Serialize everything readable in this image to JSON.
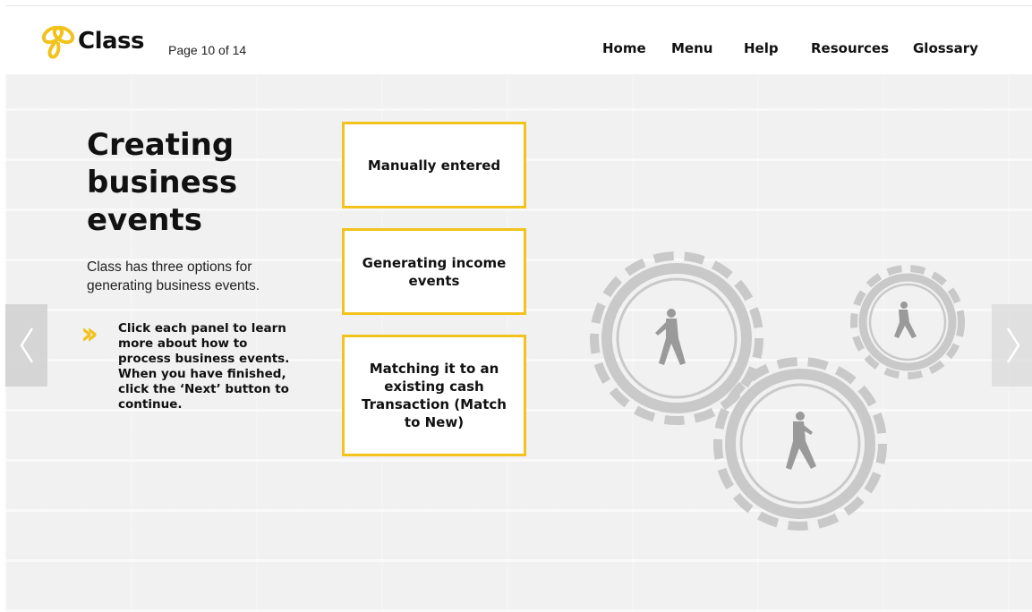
{
  "header": {
    "logo_text": "Class",
    "page_counter": "Page 10 of 14",
    "nav": [
      {
        "label": "Home"
      },
      {
        "label": "Menu"
      },
      {
        "label": "Help"
      },
      {
        "label": "Resources"
      },
      {
        "label": "Glossary"
      }
    ]
  },
  "content": {
    "title_lines": [
      "Creating",
      "business",
      "events"
    ],
    "intro": "Class has three options for generating business events.",
    "instruction": "Click each panel to learn more about how to process business events. When you have finished, click the ‘Next’ button to continue.",
    "panels": [
      {
        "label": "Manually entered"
      },
      {
        "label": "Generating income events"
      },
      {
        "label": "Matching it to an existing cash Transaction (Match to New)"
      }
    ]
  },
  "navigation": {
    "prev_icon": "chevron-left-icon",
    "next_icon": "chevron-right-icon"
  },
  "colors": {
    "accent": "#f2c21d",
    "background": "#f1f1f1",
    "text": "#111111"
  }
}
